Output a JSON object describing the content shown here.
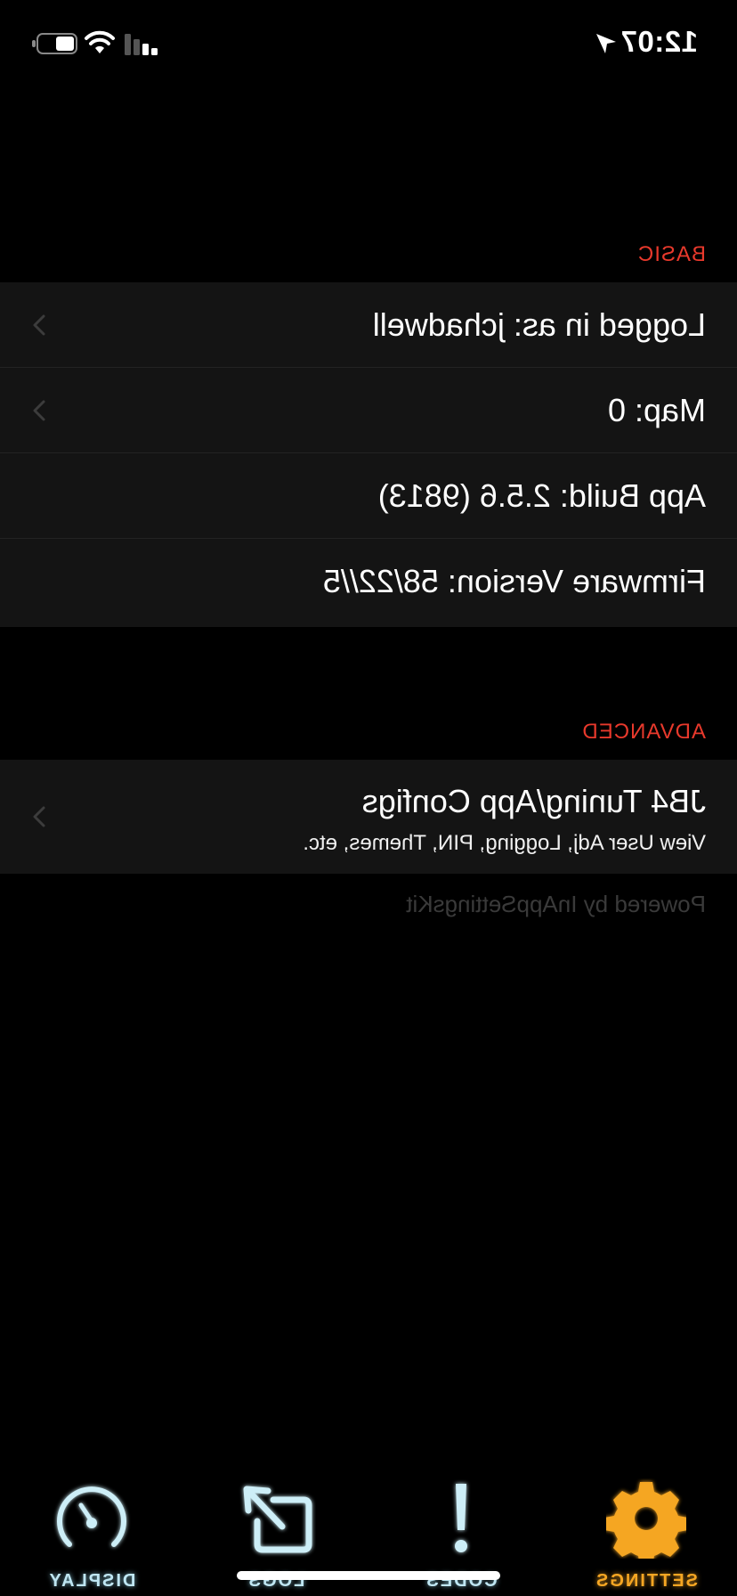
{
  "status_bar": {
    "time": "12:07",
    "location_icon": "location-arrow-icon",
    "signal_icon": "cellular-signal-icon",
    "wifi_icon": "wifi-icon",
    "battery_icon": "battery-icon"
  },
  "sections": {
    "basic": {
      "header": "BASIC",
      "rows": [
        {
          "label": "Logged in as: jchadwell"
        },
        {
          "label": "Map: 0"
        },
        {
          "label": "App Build: 2.5.6 (9813)"
        },
        {
          "label": "Firmware Version: 58/22//5"
        }
      ]
    },
    "advanced": {
      "header": "ADVANCED",
      "row": {
        "title": "JB4 Tuning/App Configs",
        "subtitle": "View User Adj, Logging, PIN, Themes, etc."
      }
    }
  },
  "footer": {
    "powered_by": "Powered by InAppSettingsKit"
  },
  "tab_bar": {
    "tabs": [
      {
        "label": "DISPLAY",
        "icon": "gauge-icon"
      },
      {
        "label": "LOGS",
        "icon": "share-log-icon"
      },
      {
        "label": "CODES",
        "icon": "exclamation-icon"
      },
      {
        "label": "SETTINGS",
        "icon": "gear-icon"
      }
    ],
    "active_tab": "SETTINGS"
  },
  "colors": {
    "background": "#000000",
    "row_background": "#141414",
    "section_header": "#e8392c",
    "tab_inactive": "#bfe6f2",
    "tab_active": "#f5a623"
  }
}
